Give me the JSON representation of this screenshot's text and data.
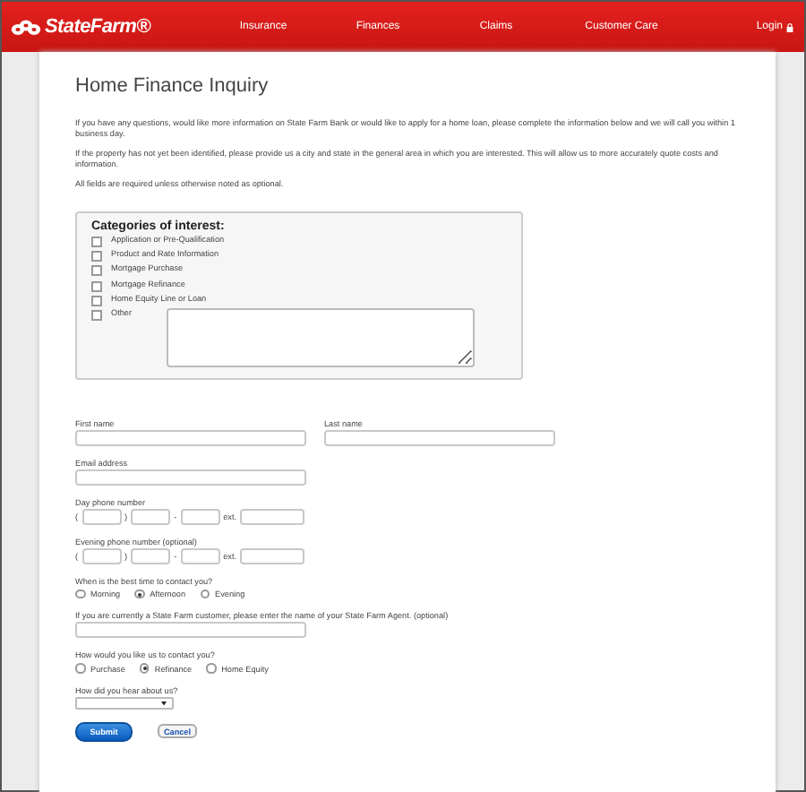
{
  "header": {
    "logo": "StateFarm®",
    "nav": [
      {
        "label": "Insurance"
      },
      {
        "label": "Finances"
      },
      {
        "label": "Claims"
      },
      {
        "label": "Customer Care"
      }
    ],
    "login": "Login"
  },
  "title": "Home Finance Inquiry",
  "paragraphs": [
    "If you have any questions, would like more information on State Farm Bank or would like to apply for a home loan, please complete the information below and we will call you within 1 business day.",
    "If the property has not yet been identified, please provide us a city and state in the general area in which you are interested. This will allow us to more accurately quote costs and information.",
    "All fields are required unless otherwise noted as optional."
  ],
  "categories": {
    "title": "Categories of interest:",
    "options": [
      {
        "label": "Application or Pre-Qualification",
        "checked": false
      },
      {
        "label": "Product and Rate Information",
        "checked": false
      },
      {
        "label": "Mortgage Purchase",
        "checked": false
      },
      {
        "label": "Mortgage Refinance",
        "checked": false
      },
      {
        "label": "Home Equity Line or Loan",
        "checked": false
      },
      {
        "label": "Other",
        "checked": false,
        "kind": "other"
      }
    ]
  },
  "form": [
    {
      "kind": "pair",
      "fields": [
        {
          "label": "First name"
        },
        {
          "label": "Last name"
        }
      ]
    },
    {
      "kind": "text",
      "label": "Email address"
    },
    {
      "kind": "phone",
      "label": "Day phone number",
      "open": "(",
      "close": ")",
      "dash": "-",
      "ext": "ext."
    },
    {
      "kind": "phone",
      "label": "Evening phone number (optional)",
      "open": "(",
      "close": ")",
      "dash": "-",
      "ext": "ext."
    },
    {
      "kind": "radio",
      "label": "When is the best time to contact you?",
      "options": [
        {
          "label": "Morning",
          "selected": false
        },
        {
          "label": "Afternoon",
          "selected": true
        },
        {
          "label": "Evening",
          "selected": false
        }
      ]
    },
    {
      "kind": "text",
      "label": "If you are currently a State Farm customer, please enter the name of your State Farm Agent. (optional)"
    },
    {
      "kind": "radio",
      "label": "How would you like us to contact you?",
      "options": [
        {
          "label": "Purchase",
          "selected": false
        },
        {
          "label": "Refinance",
          "selected": true
        },
        {
          "label": "Home Equity",
          "selected": false
        }
      ]
    },
    {
      "kind": "select",
      "label": "How did you hear about us?"
    }
  ],
  "buttons": [
    {
      "label": "Submit",
      "kind": "primary"
    },
    {
      "label": "Cancel",
      "kind": "secondary"
    }
  ]
}
